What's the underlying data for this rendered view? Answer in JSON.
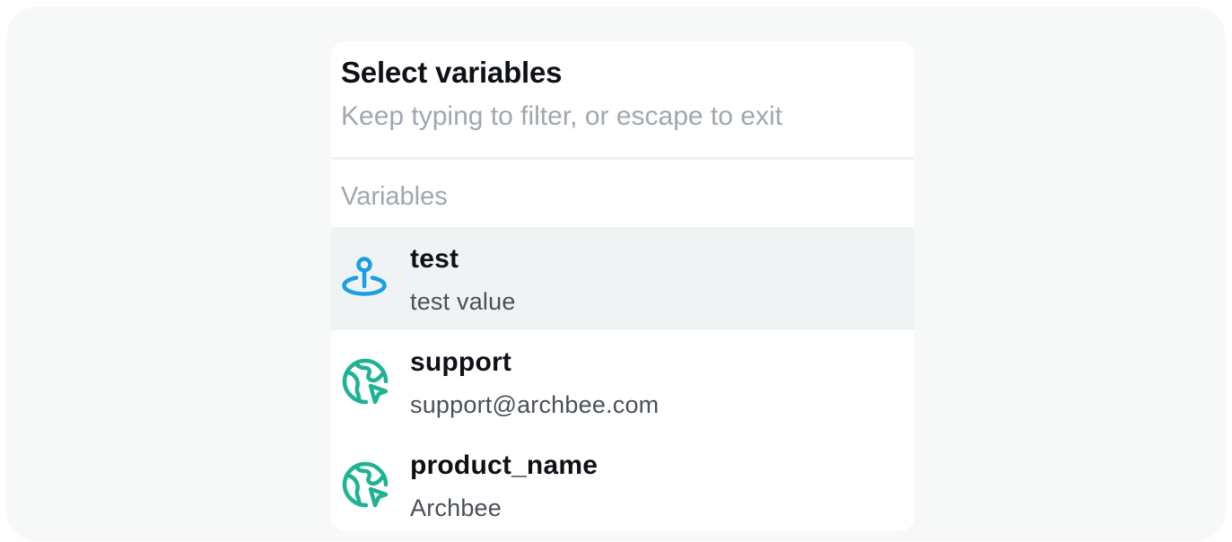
{
  "header": {
    "title": "Select variables",
    "subtitle": "Keep typing to filter, or escape to exit"
  },
  "section": {
    "label": "Variables"
  },
  "variables": [
    {
      "name": "test",
      "value": "test value",
      "icon": "location-pin-icon",
      "icon_color": "#1a9ee6",
      "selected": true
    },
    {
      "name": "support",
      "value": "support@archbee.com",
      "icon": "globe-cursor-icon",
      "icon_color": "#1fb394",
      "selected": false
    },
    {
      "name": "product_name",
      "value": "Archbee",
      "icon": "globe-cursor-icon",
      "icon_color": "#1fb394",
      "selected": false
    }
  ],
  "colors": {
    "highlight": "#f0f3f4",
    "pin_icon": "#1a9ee6",
    "globe_icon": "#1fb394"
  }
}
